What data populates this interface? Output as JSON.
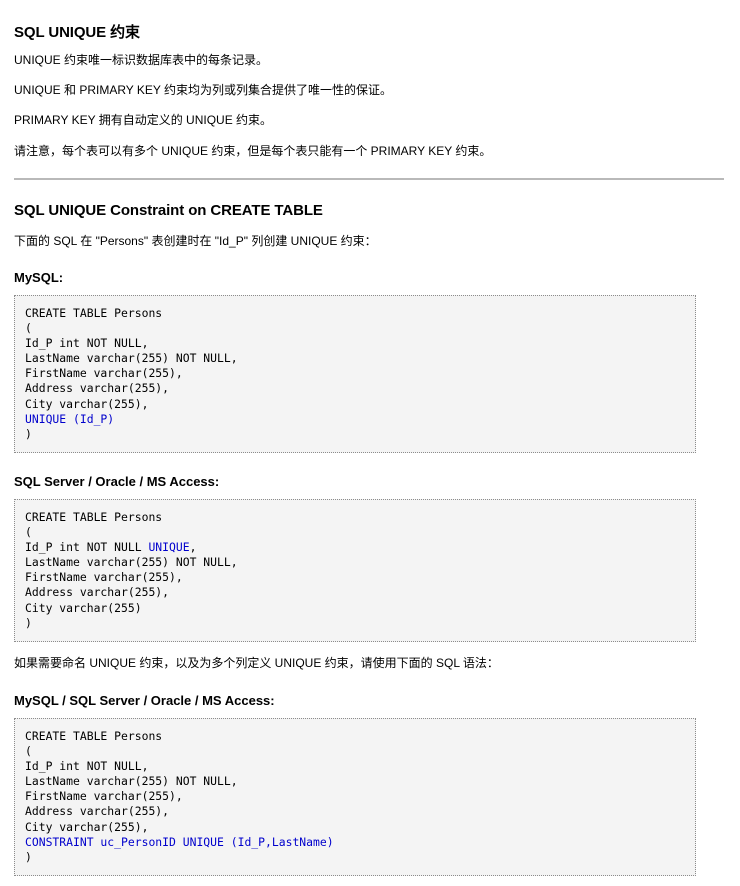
{
  "section1": {
    "title": "SQL UNIQUE 约束",
    "paragraphs": [
      "UNIQUE 约束唯一标识数据库表中的每条记录。",
      "UNIQUE 和 PRIMARY KEY 约束均为列或列集合提供了唯一性的保证。",
      "PRIMARY KEY 拥有自动定义的 UNIQUE 约束。",
      "请注意，每个表可以有多个 UNIQUE 约束，但是每个表只能有一个 PRIMARY KEY 约束。"
    ]
  },
  "section2": {
    "title": "SQL UNIQUE Constraint on CREATE TABLE",
    "intro": "下面的 SQL 在 \"Persons\" 表创建时在 \"Id_P\" 列创建 UNIQUE 约束：",
    "mysql_heading": "MySQL:",
    "mysql_code": [
      "CREATE TABLE Persons",
      "(",
      "Id_P int NOT NULL,",
      "LastName varchar(255) NOT NULL,",
      "FirstName varchar(255),",
      "Address varchar(255),",
      "City varchar(255),",
      "UNIQUE (Id_P)",
      ")"
    ],
    "sqlserver_heading": "SQL Server / Oracle / MS Access:",
    "sqlserver_code": [
      "CREATE TABLE Persons",
      "(",
      "Id_P int NOT NULL ",
      "UNIQUE",
      ",",
      "LastName varchar(255) NOT NULL,",
      "FirstName varchar(255),",
      "Address varchar(255),",
      "City varchar(255)",
      ")"
    ],
    "naming_text": "如果需要命名 UNIQUE 约束，以及为多个列定义 UNIQUE 约束，请使用下面的 SQL 语法：",
    "all_heading": "MySQL / SQL Server / Oracle / MS Access:",
    "all_code": [
      "CREATE TABLE Persons",
      "(",
      "Id_P int NOT NULL,",
      "LastName varchar(255) NOT NULL,",
      "FirstName varchar(255),",
      "Address varchar(255),",
      "City varchar(255),",
      "CONSTRAINT uc_PersonID UNIQUE (Id_P,LastName)",
      ")"
    ]
  },
  "colors": {
    "highlight": "#0000cc",
    "code_background": "#f4f4f4",
    "rule": "#b9b9b9"
  }
}
